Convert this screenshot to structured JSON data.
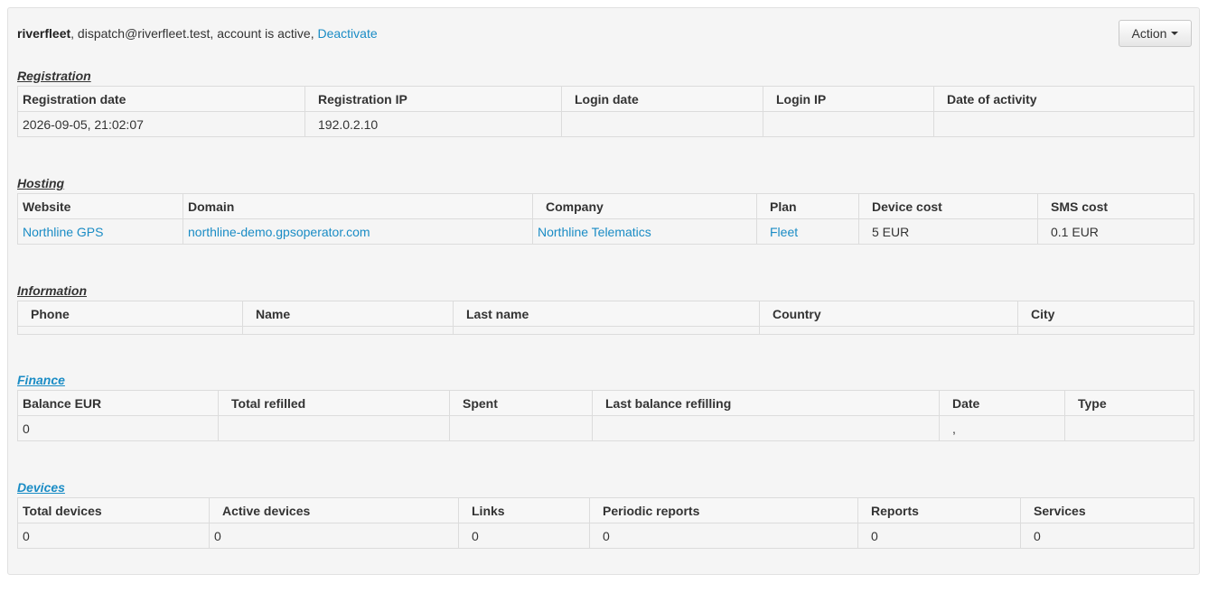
{
  "header": {
    "username": "riverfleet",
    "rest": ", dispatch@riverfleet.test, account is active, ",
    "deactivate": "Deactivate",
    "action_label": "Action"
  },
  "registration": {
    "title": "Registration",
    "columns": [
      "Registration date",
      "Registration IP",
      "Login date",
      "Login IP",
      "Date of activity"
    ],
    "row": [
      "2026-09-05, 21:02:07",
      "192.0.2.10",
      "",
      "",
      ""
    ]
  },
  "hosting": {
    "title": "Hosting",
    "columns": [
      "Website",
      "Domain",
      "Company",
      "Plan",
      "Device cost",
      "SMS cost"
    ],
    "row": [
      "Northline GPS",
      "northline-demo.gpsoperator.com",
      "Northline Telematics",
      "Fleet",
      "5 EUR",
      "0.1 EUR"
    ]
  },
  "information": {
    "title": "Information",
    "columns": [
      "Phone",
      "Name",
      "Last name",
      "Country",
      "City"
    ]
  },
  "finance": {
    "title": "Finance",
    "columns": [
      "Balance EUR",
      "Total refilled",
      "Spent",
      "Last balance refilling",
      "Date",
      "Type"
    ],
    "row": [
      "0",
      "",
      "",
      "",
      ",",
      ""
    ]
  },
  "devices": {
    "title": "Devices",
    "columns": [
      "Total devices",
      "Active devices",
      "Links",
      "Periodic reports",
      "Reports",
      "Services"
    ],
    "row": [
      "0",
      "0",
      "0",
      "0",
      "0",
      "0"
    ]
  },
  "colors": {
    "link": "#1a8cc5",
    "panel_bg": "#f5f5f5",
    "border": "#dcdcdc"
  }
}
